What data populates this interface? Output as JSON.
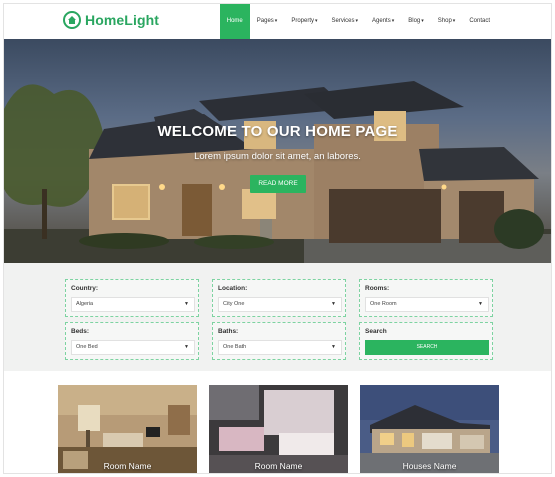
{
  "brand": {
    "name": "HomeLight",
    "color": "#2aa660"
  },
  "nav": {
    "items": [
      {
        "label": "Home",
        "caret": "",
        "active": true
      },
      {
        "label": "Pages",
        "caret": "▾"
      },
      {
        "label": "Property",
        "caret": "▾"
      },
      {
        "label": "Services",
        "caret": "▾"
      },
      {
        "label": "Agents",
        "caret": "▾"
      },
      {
        "label": "Blog",
        "caret": "▾"
      },
      {
        "label": "Shop",
        "caret": "▾"
      },
      {
        "label": "Contact",
        "caret": ""
      }
    ]
  },
  "hero": {
    "title": "WELCOME TO OUR HOME PAGE",
    "subtitle": "Lorem ipsum dolor sit amet, an labores.",
    "button": "READ MORE"
  },
  "search": {
    "country": {
      "label": "Country:",
      "value": "Algeria"
    },
    "location": {
      "label": "Location:",
      "value": "City One"
    },
    "rooms": {
      "label": "Rooms:",
      "value": "One Room"
    },
    "beds": {
      "label": "Beds:",
      "value": "One Bed"
    },
    "baths": {
      "label": "Baths:",
      "value": "One Bath"
    },
    "search": {
      "label": "Search",
      "button": "SEARCH"
    }
  },
  "cards": [
    {
      "label": "Room Name"
    },
    {
      "label": "Room Name"
    },
    {
      "label": "Houses Name"
    }
  ],
  "colors": {
    "accent": "#2bb45f",
    "search_bg": "#f1f2f1",
    "field_border": "#7dd3a1"
  }
}
